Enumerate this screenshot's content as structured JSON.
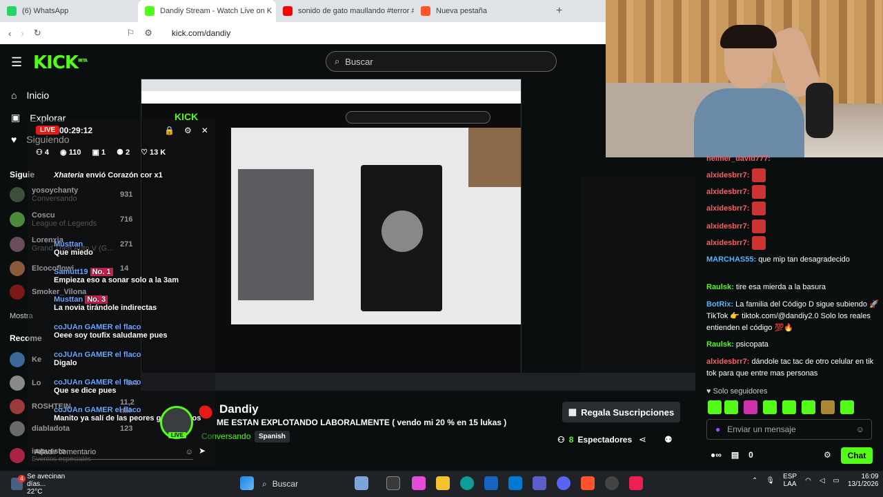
{
  "browser": {
    "tabs": [
      {
        "label": "(6) WhatsApp",
        "color": "#25d366"
      },
      {
        "label": "Dandiy Stream - Watch Live on K",
        "color": "#53fc18",
        "active": true
      },
      {
        "label": "sonido de gato maullando #terror #",
        "color": "#ff0000"
      },
      {
        "label": "Nueva pestaña",
        "color": "#fb542b"
      }
    ],
    "new_tab": "+",
    "url": "kick.com/dandiy"
  },
  "site": {
    "logo": "KICK",
    "logo_beta": "BETA",
    "search_placeholder": "Buscar",
    "nav": [
      "Inicio",
      "Explorar",
      "Siguiendo"
    ],
    "sidebar_section": "Siguie",
    "sidebar_channels": [
      {
        "name": "yosoychanty",
        "sub": "Conversando",
        "viewers": "931"
      },
      {
        "name": "Coscu",
        "sub": "League of Legends",
        "viewers": "716"
      },
      {
        "name": "Lorenxia",
        "sub": "Grand Theft Auto V (G...",
        "viewers": "271"
      },
      {
        "name": "Elcocoflowi",
        "sub": "",
        "viewers": "14"
      },
      {
        "name": "Smoker_Vilona",
        "sub": "",
        "viewers": ""
      }
    ],
    "show_more": "Mostra",
    "recommended": "Recome",
    "rec_channels": [
      {
        "name": "Ke",
        "viewers": ""
      },
      {
        "name": "Lo",
        "viewers": "5.4"
      },
      {
        "name": "ROSHTEIN",
        "viewers": "11,2 mil"
      },
      {
        "name": "diabladota",
        "viewers": "123"
      },
      {
        "name": "impuesto",
        "viewers": "6,1 mil"
      }
    ],
    "special_events": "Eventos especiales"
  },
  "overlay": {
    "live": "LIVE",
    "timer": "00:29:12",
    "stats": [
      "4",
      "110",
      "1",
      "2",
      "13 K"
    ],
    "gift": "Xhateria",
    "gift_text": "envió Corazón cor",
    "gift_count": "x1",
    "messages": [
      {
        "user": "Musttan",
        "text": "Que miedo"
      },
      {
        "user": "Samutt19",
        "badge": "No. 1",
        "text": "Empieza eso a sonar solo a la 3am"
      },
      {
        "user": "Musttan",
        "badge": "No. 3",
        "text": "La novia tirándole indirectas"
      },
      {
        "user": "coJUAn GAMER el flaco",
        "text": "Oeee soy toufix saludame pues"
      },
      {
        "user": "coJUAn GAMER el flaco",
        "text": "Digalo"
      },
      {
        "user": "coJUAn GAMER el flaco",
        "text": "Que se dice pues"
      },
      {
        "user": "coJUAn GAMER el flaco",
        "text": "Manito ya salí de las peores grax ah dios"
      }
    ],
    "comment_placeholder": "Añadir comentario"
  },
  "stream": {
    "streamer": "Dandiy",
    "title": "ME ESTAN EXPLOTANDO LABORALMENTE ( vendo mi 20 % en 15 lukas )",
    "category": "Conversando",
    "language": "Spanish",
    "subscribe_button": "Regala Suscripciones",
    "viewers_count": "8",
    "viewers_label": "Espectadores"
  },
  "chat": {
    "messages": [
      {
        "user": "heimer_david777:",
        "type": "r"
      },
      {
        "user": "alxidesbrr7:",
        "type": "r"
      },
      {
        "user": "alxidesbrr7:",
        "type": "r"
      },
      {
        "user": "alxidesbrr7:",
        "type": "r"
      },
      {
        "user": "alxidesbrr7:",
        "type": "r"
      },
      {
        "user": "alxidesbrr7:",
        "type": "r"
      },
      {
        "user": "MARCHAS55:",
        "text": "que mip tan desagradecido",
        "type": "b"
      },
      {
        "user": "Raulsk:",
        "text": "tire esa mierda a la basura",
        "type": "g"
      },
      {
        "user": "BotRix:",
        "text": "La familia del Código D sigue subiendo 🚀 TikTok 👉 tiktok.com/@dandiy2.0 Solo los reales entienden el código 💯🔥",
        "type": "b"
      },
      {
        "user": "Raulsk:",
        "text": "psicopata",
        "type": "g"
      },
      {
        "user": "alxidesbrr7:",
        "text": "dándole tac tac de otro celular en tik tok para que entre mas personas",
        "type": "r"
      }
    ],
    "followers_only": "Solo seguidores",
    "input_placeholder": "Enviar un mensaje",
    "points": "0",
    "chat_button": "Chat"
  },
  "taskbar": {
    "weather_title": "Se avecinan días...",
    "weather_temp": "22°C",
    "weather_badge": "4",
    "search": "Buscar",
    "lang1": "ESP",
    "lang2": "LAA",
    "time": "16:09",
    "date": "13/1/2026"
  }
}
